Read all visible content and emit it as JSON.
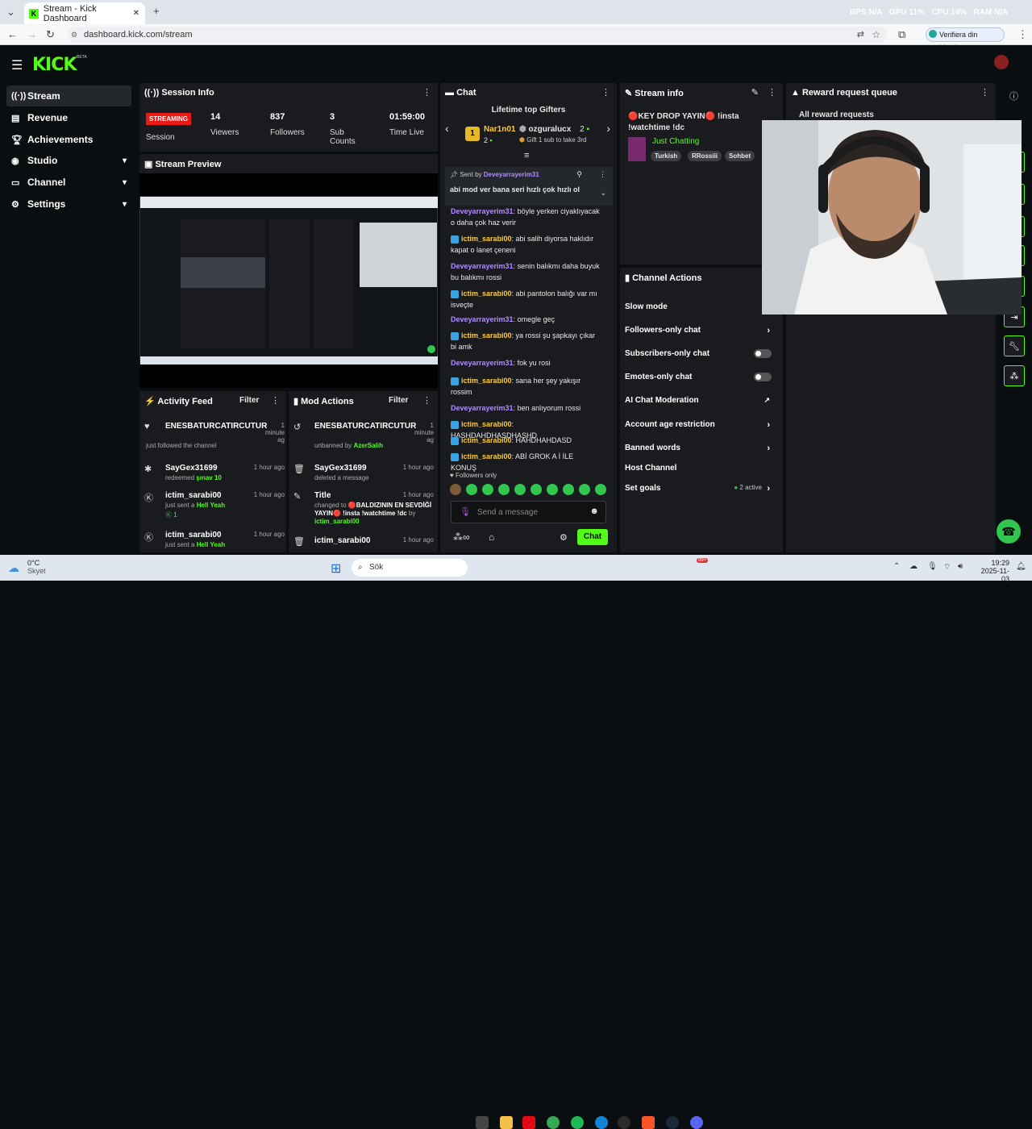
{
  "browser": {
    "tab_title": "Stream - Kick Dashboard",
    "url": "dashboard.kick.com/stream",
    "identity_button": "Verifiera din identitet",
    "perf": {
      "bps_label": "BPS",
      "bps": "N/A",
      "gpu_label": "GPU",
      "gpu": "11%",
      "cpu_label": "CPU",
      "cpu": "14%",
      "ram_label": "RAM",
      "ram": "N/A"
    }
  },
  "header": {
    "logo": "KICK",
    "beta": "BETA"
  },
  "sidebar": {
    "items": [
      {
        "label": "Stream",
        "icon": "stream-icon"
      },
      {
        "label": "Revenue",
        "icon": "revenue-icon"
      },
      {
        "label": "Achievements",
        "icon": "trophy-icon"
      },
      {
        "label": "Studio",
        "icon": "studio-icon"
      },
      {
        "label": "Channel",
        "icon": "channel-icon"
      },
      {
        "label": "Settings",
        "icon": "gear-icon"
      }
    ]
  },
  "session": {
    "title": "Session Info",
    "status": "STREAMING",
    "session_label": "Session",
    "stats": [
      {
        "value": "14",
        "label": "Viewers"
      },
      {
        "value": "837",
        "label": "Followers"
      },
      {
        "value": "3",
        "label": "Sub Counts"
      },
      {
        "value": "01:59:00",
        "label": "Time Live"
      }
    ]
  },
  "preview": {
    "title": "Stream Preview"
  },
  "activity": {
    "title": "Activity Feed",
    "filter": "Filter",
    "items": [
      {
        "user": "ENESBATURCATIRCUTUR",
        "time": "1 minute ag",
        "text": "just followed the channel",
        "extra": ""
      },
      {
        "user": "SayGex31699",
        "time": "1 hour ago",
        "text": "redeemed",
        "extra": "şınav 10"
      },
      {
        "user": "ictim_sarabi00",
        "time": "1 hour ago",
        "text": "just sent a",
        "extra": "Hell Yeah",
        "count": "1"
      },
      {
        "user": "ictim_sarabi00",
        "time": "1 hour ago",
        "text": "just sent a",
        "extra": "Hell Yeah"
      }
    ]
  },
  "mod": {
    "title": "Mod Actions",
    "filter": "Filter",
    "items": [
      {
        "user": "ENESBATURCATIRCUTUR",
        "time": "1 minute ag",
        "text": "unbanned by",
        "extra": "AzerSalih"
      },
      {
        "user": "SayGex31699",
        "time": "1 hour ago",
        "text": "deleted a message",
        "extra": ""
      },
      {
        "user": "Title",
        "time": "1 hour ago",
        "text": "changed to",
        "extra": "🔴BALDIZININ EN SEVDİĞİ YAYIN🔴 !insta !watchtime !dc",
        "by_label": "by",
        "by": "ictim_sarabi00"
      },
      {
        "user": "ictim_sarabi00",
        "time": "1 hour ago",
        "text": "",
        "extra": ""
      }
    ]
  },
  "chat": {
    "title": "Chat",
    "gifters_title": "Lifetime top Gifters",
    "gifter1": {
      "rank": "1",
      "name": "Nar1n01",
      "count": "2"
    },
    "gifter2": {
      "name": "ozguralucx",
      "count": "2"
    },
    "gift_cta": "Gift 1 sub to take 3rd",
    "pinned": {
      "label": "Sent by",
      "user": "Deveyarrayerim31",
      "text": "abi mod ver bana seri hızlı çok hızlı ol"
    },
    "messages": [
      {
        "user": "Deveyarrayerim31",
        "text": ": böyle yerken ciyaklıyacak o daha çok haz verir",
        "type": "1"
      },
      {
        "user": "ictim_sarabi00",
        "text": ": abi salih diyorsa haklıdır kapat o lanet çeneni",
        "type": "2"
      },
      {
        "user": "Deveyarrayerim31",
        "text": ": senin balıkmı daha buyuk bu balıkmı rossi",
        "type": "1"
      },
      {
        "user": "ictim_sarabi00",
        "text": ": abi pantolon balığı var mı isveçte",
        "type": "2"
      },
      {
        "user": "Deveyarrayerim31",
        "text": ": omegle geç",
        "type": "1"
      },
      {
        "user": "ictim_sarabi00",
        "text": ": ya rossi şu şapkayı çıkar bi amk",
        "type": "2"
      },
      {
        "user": "Deveyarrayerim31",
        "text": ": fok yu rosi",
        "type": "1"
      },
      {
        "user": "ictim_sarabi00",
        "text": ": sana her şey yakışır rossim",
        "type": "2"
      },
      {
        "user": "Deveyarrayerim31",
        "text": ": ben anlıyorum rossi",
        "type": "1"
      },
      {
        "user": "ictim_sarabi00",
        "text": ": HASHDAHDHASDHASHD",
        "type": "2"
      },
      {
        "user": "ictim_sarabi00",
        "text": ": HAHDHAHDASD",
        "type": "2"
      },
      {
        "user": "ictim_sarabi00",
        "text": ": ABİ GROK A İ İLE KONUŞ",
        "type": "2"
      }
    ],
    "followers_only": "Followers only",
    "placeholder": "Send a message",
    "send": "Chat"
  },
  "stream_info": {
    "title": "Stream info",
    "stream_title": "🔴KEY DROP YAYIN🔴 !insta !watchtime !dc",
    "category": "Just Chatting",
    "tags": [
      "Turkish",
      "RRossiii",
      "Sohbet"
    ]
  },
  "rewards": {
    "title": "Reward request queue",
    "all": "All reward requests"
  },
  "channel_actions": {
    "title": "Channel Actions",
    "items": [
      {
        "label": "Slow mode",
        "ctrl": "none"
      },
      {
        "label": "Followers-only chat",
        "ctrl": "chevron"
      },
      {
        "label": "Subscribers-only chat",
        "ctrl": "toggle"
      },
      {
        "label": "Emotes-only chat",
        "ctrl": "toggle"
      },
      {
        "label": "AI Chat Moderation",
        "ctrl": "external"
      },
      {
        "label": "Account age restriction",
        "ctrl": "chevron"
      },
      {
        "label": "Banned words",
        "ctrl": "chevron"
      },
      {
        "label": "Host Channel",
        "ctrl": "none"
      },
      {
        "label": "Set goals",
        "ctrl": "chevron",
        "badge": "2 active"
      }
    ]
  },
  "taskbar": {
    "weather_temp": "0°C",
    "weather_desc": "Skyet",
    "search": "Sök",
    "time": "19:29",
    "date": "2025-11-03",
    "notif": "99+"
  },
  "colors": {
    "accent": "#53fc18",
    "live": "#e91916",
    "panel": "#191b1f",
    "bg": "#0b0e10"
  }
}
